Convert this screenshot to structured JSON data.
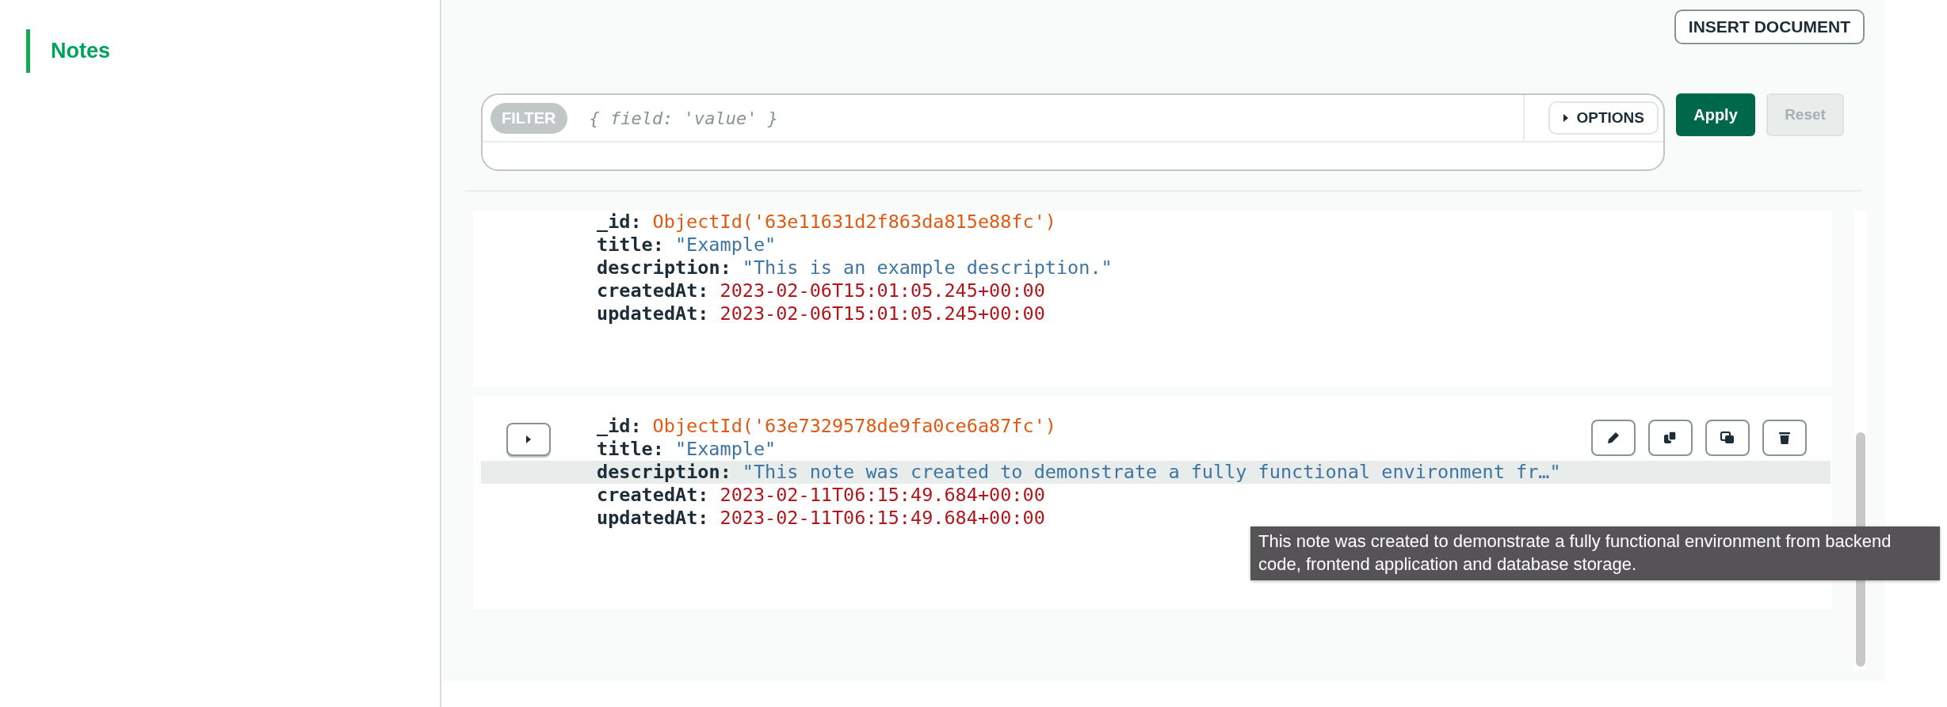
{
  "sidebar": {
    "items": [
      {
        "label": "Notes",
        "selected": true
      }
    ]
  },
  "toolbar": {
    "insert_button": "INSERT DOCUMENT"
  },
  "filter": {
    "badge": "FILTER",
    "placeholder": "{ field: 'value' }",
    "options_button": "OPTIONS",
    "apply_button": "Apply",
    "reset_button": "Reset",
    "reset_disabled": true
  },
  "documents": [
    {
      "hovered": false,
      "fields": [
        {
          "key": "_id:",
          "value": "ObjectId('63e11631d2f863da815e88fc')",
          "kind": "objectid",
          "highlighted": false
        },
        {
          "key": "title:",
          "value": "\"Example\"",
          "kind": "string",
          "highlighted": false
        },
        {
          "key": "description:",
          "value": "\"This is an example description.\"",
          "kind": "string",
          "highlighted": false
        },
        {
          "key": "createdAt:",
          "value": "2023-02-06T15:01:05.245+00:00",
          "kind": "date",
          "highlighted": false
        },
        {
          "key": "updatedAt:",
          "value": "2023-02-06T15:01:05.245+00:00",
          "kind": "date",
          "highlighted": false
        }
      ]
    },
    {
      "hovered": true,
      "fields": [
        {
          "key": "_id:",
          "value": "ObjectId('63e7329578de9fa0ce6a87fc')",
          "kind": "objectid",
          "highlighted": false
        },
        {
          "key": "title:",
          "value": "\"Example\"",
          "kind": "string",
          "highlighted": false
        },
        {
          "key": "description:",
          "value": "\"This note was created to demonstrate a fully functional environment fr…\"",
          "kind": "string",
          "highlighted": true
        },
        {
          "key": "createdAt:",
          "value": "2023-02-11T06:15:49.684+00:00",
          "kind": "date",
          "highlighted": false
        },
        {
          "key": "updatedAt:",
          "value": "2023-02-11T06:15:49.684+00:00",
          "kind": "date",
          "highlighted": false
        }
      ]
    }
  ],
  "tooltip": {
    "text": "This note was created to demonstrate a fully functional environment from backend code, frontend application and database storage."
  }
}
